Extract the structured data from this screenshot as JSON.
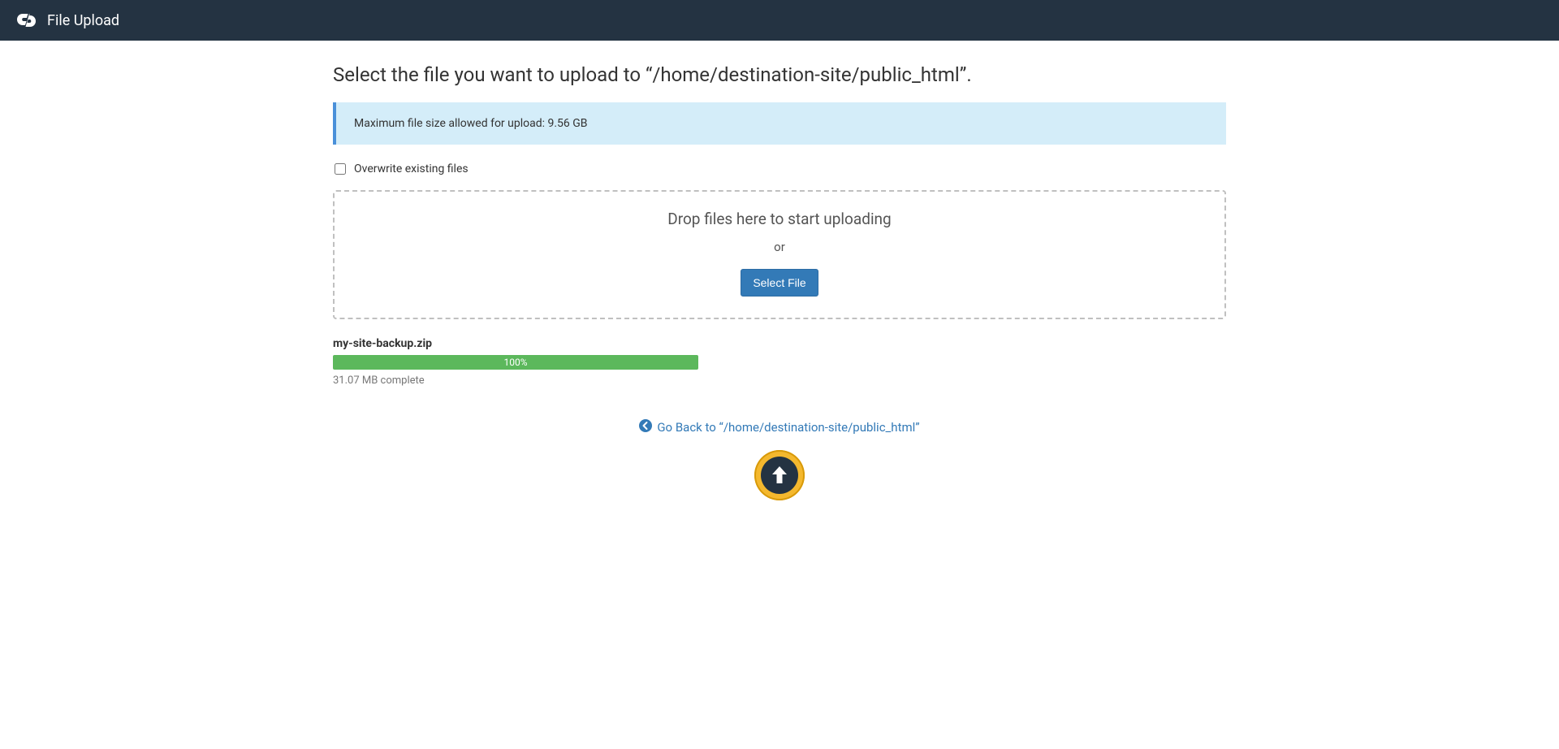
{
  "header": {
    "title": "File Upload"
  },
  "page": {
    "heading_prefix": "Select the file you want to upload to ",
    "heading_path": "“/home/destination-site/public_html”",
    "heading_suffix": ".",
    "info_banner": "Maximum file size allowed for upload: 9.56 GB",
    "overwrite_label": "Overwrite existing files",
    "overwrite_checked": false
  },
  "dropzone": {
    "drop_text": "Drop files here to start uploading",
    "or_text": "or",
    "select_button": "Select File"
  },
  "upload": {
    "filename": "my-site-backup.zip",
    "progress_percent": "100%",
    "status": "31.07 MB complete"
  },
  "footer": {
    "go_back_prefix": "Go Back to ",
    "go_back_path": "“/home/destination-site/public_html”"
  }
}
